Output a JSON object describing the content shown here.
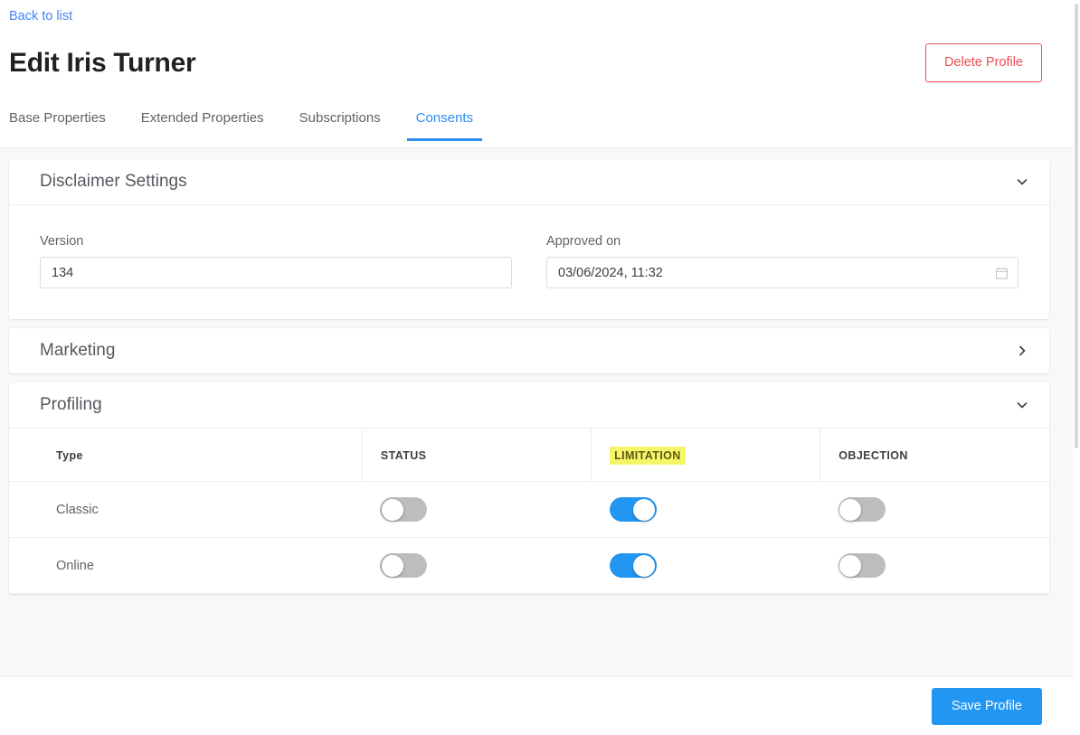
{
  "header": {
    "back_link": "Back to list",
    "title": "Edit Iris Turner",
    "delete_label": "Delete Profile"
  },
  "tabs": [
    {
      "label": "Base Properties",
      "active": false
    },
    {
      "label": "Extended Properties",
      "active": false
    },
    {
      "label": "Subscriptions",
      "active": false
    },
    {
      "label": "Consents",
      "active": true
    }
  ],
  "sections": {
    "disclaimer": {
      "title": "Disclaimer Settings",
      "expanded": true,
      "chevron": "chevron-down-icon",
      "fields": {
        "version": {
          "label": "Version",
          "value": "134",
          "placeholder": "Version"
        },
        "approved_on": {
          "label": "Approved on",
          "value": "03/06/2024, 11:32",
          "placeholder": "Approved on",
          "icon": "calendar-icon"
        }
      }
    },
    "marketing": {
      "title": "Marketing",
      "expanded": false,
      "chevron": "chevron-right-icon"
    },
    "profiling": {
      "title": "Profiling",
      "expanded": true,
      "chevron": "chevron-down-icon",
      "table": {
        "columns": [
          {
            "label": "Type",
            "highlighted": false
          },
          {
            "label": "STATUS",
            "highlighted": false
          },
          {
            "label": "LIMITATION",
            "highlighted": true
          },
          {
            "label": "OBJECTION",
            "highlighted": false
          }
        ],
        "rows": [
          {
            "type": "Classic",
            "status": false,
            "limitation": true,
            "objection": false
          },
          {
            "type": "Online",
            "status": false,
            "limitation": true,
            "objection": false
          }
        ]
      }
    }
  },
  "footer": {
    "save_label": "Save Profile"
  },
  "colors": {
    "link": "#4285f4",
    "accent": "#2196f3",
    "tab_active": "#2b8cf0",
    "danger": "#ea4f54",
    "highlight_bg": "#f5f568",
    "highlight_text": "#5c5c14",
    "toggle_off": "#bdbdbd",
    "page_bg": "#f7f8f9"
  }
}
